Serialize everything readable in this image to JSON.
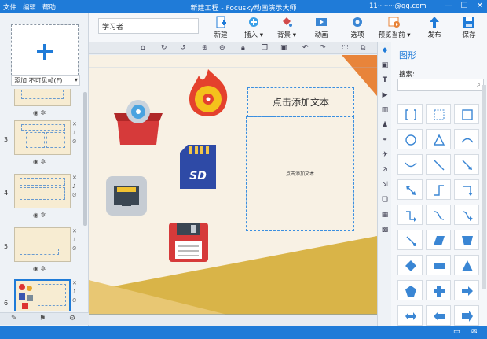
{
  "titlebar": {
    "menu_file": "文件",
    "menu_edit": "编辑",
    "menu_help": "帮助",
    "app_title": "新建工程 - Focusky动画演示大师",
    "account": "11········@qq.com",
    "min": "—",
    "max": "☐",
    "close": "✕"
  },
  "toolbar": {
    "title_value": "学习者",
    "new": "新建",
    "insert": "插入",
    "background": "背景",
    "animation": "动画",
    "options": "选项",
    "preview": "预览当前",
    "publish": "发布",
    "save": "保存"
  },
  "leftpanel": {
    "add_label": "添加 不可见帧(F)",
    "slides": [
      {
        "num": ""
      },
      {
        "num": "3"
      },
      {
        "num": "4"
      },
      {
        "num": "5"
      },
      {
        "num": "6"
      }
    ]
  },
  "canvas": {
    "title_placeholder": "点击添加文本",
    "body_placeholder": "点击添加文本",
    "icons": [
      "disc-box-icon",
      "fire-disc-icon",
      "sd-card-icon",
      "network-port-icon",
      "floppy-disk-icon"
    ]
  },
  "shapes_panel": {
    "title": "图形",
    "search_label": "搜索:",
    "search_value": "",
    "items": [
      "bracket-icon",
      "dotted-rect-icon",
      "rect-icon",
      "circle-icon",
      "triangle-icon",
      "arc-icon",
      "curve-icon",
      "line-icon",
      "arrow-line-icon",
      "double-arrow-icon",
      "step-line-icon",
      "elbow-arrow-icon",
      "step-arrow-icon",
      "s-curve-icon",
      "curve-arrow-icon",
      "line-dot-icon",
      "parallelogram-icon",
      "trapezoid-icon",
      "diamond-icon",
      "rect-fill-icon",
      "triangle-fill-icon",
      "pentagon-icon",
      "cross-icon",
      "arrow-right-icon",
      "double-arrow-fill-icon",
      "arrow-left-icon",
      "arrow-right-fill-icon"
    ]
  },
  "colors": {
    "accent": "#1f7bd8",
    "canvas_bg": "#f8f1e4",
    "shape_blue": "#3a86d4",
    "ochre": "#d9b448",
    "orange": "#e8843a"
  }
}
